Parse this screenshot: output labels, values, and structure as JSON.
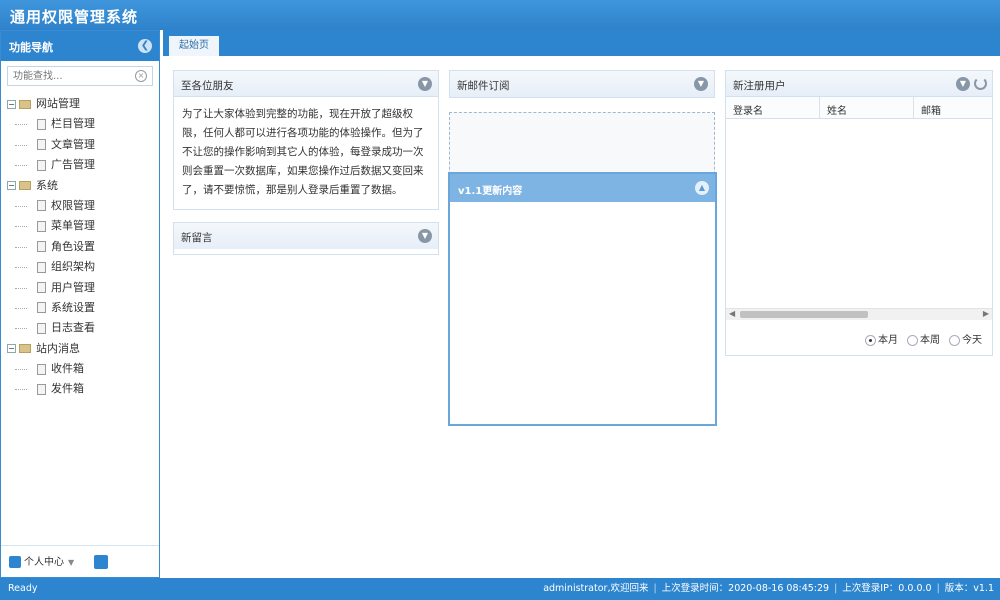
{
  "app": {
    "title": "通用权限管理系统"
  },
  "sidebar": {
    "header": "功能导航",
    "search_placeholder": "功能查找...",
    "tree": [
      {
        "label": "网站管理",
        "children": [
          "栏目管理",
          "文章管理",
          "广告管理"
        ]
      },
      {
        "label": "系统",
        "children": [
          "权限管理",
          "菜单管理",
          "角色设置",
          "组织架构",
          "用户管理",
          "系统设置",
          "日志查看"
        ]
      },
      {
        "label": "站内消息",
        "children": [
          "收件箱",
          "发件箱"
        ]
      }
    ],
    "footer": {
      "personal_center": "个人中心"
    }
  },
  "tabs": [
    {
      "label": "起始页"
    }
  ],
  "panels": {
    "welcome": {
      "title": "至各位朋友",
      "body": "为了让大家体验到完整的功能，现在开放了超级权限，任何人都可以进行各项功能的体验操作。但为了不让您的操作影响到其它人的体验，每登录成功一次则会重置一次数据库，如果您操作过后数据又变回来了，请不要惊慌，那是别人登录后重置了数据。"
    },
    "new_message": {
      "title": "新留言"
    },
    "mail_subscribe": {
      "title": "新邮件订阅"
    },
    "update": {
      "title": "v1.1更新内容"
    },
    "new_users": {
      "title": "新注册用户",
      "columns": [
        "登录名",
        "姓名",
        "邮箱"
      ],
      "filters": [
        {
          "label": "本月",
          "selected": true
        },
        {
          "label": "本周",
          "selected": false
        },
        {
          "label": "今天",
          "selected": false
        }
      ]
    }
  },
  "status": {
    "left": "Ready",
    "welcome": "administrator,欢迎回来",
    "last_login_time": "上次登录时间：2020-08-16 08:45:29",
    "last_login_ip": "上次登录IP：0.0.0.0",
    "version": "版本：v1.1"
  }
}
